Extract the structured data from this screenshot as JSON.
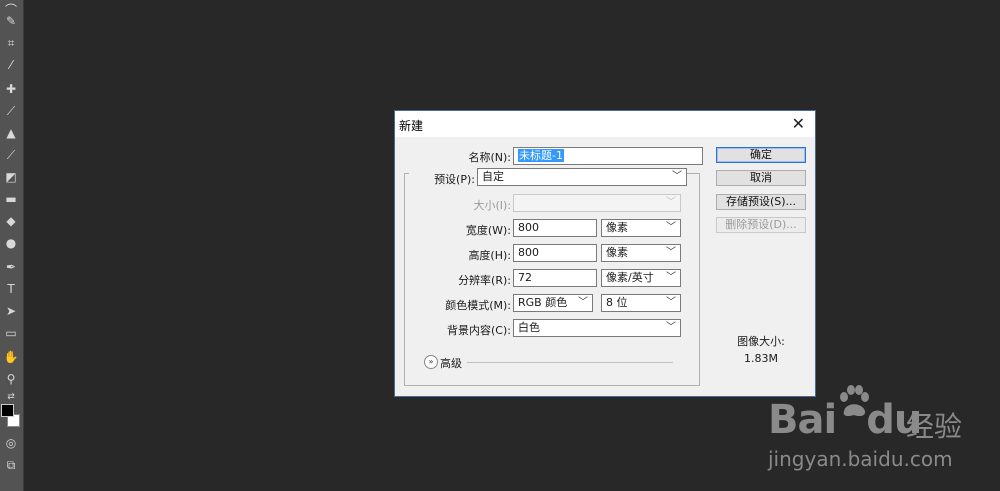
{
  "dialog": {
    "title": "新建",
    "name_label": "名称(N):",
    "name_value": "未标题-1",
    "preset_label": "预设(P):",
    "preset_value": "自定",
    "size_label": "大小(I):",
    "size_value": "",
    "width_label": "宽度(W):",
    "width_value": "800",
    "width_unit": "像素",
    "height_label": "高度(H):",
    "height_value": "800",
    "height_unit": "像素",
    "resolution_label": "分辨率(R):",
    "resolution_value": "72",
    "resolution_unit": "像素/英寸",
    "color_mode_label": "颜色模式(M):",
    "color_mode_value": "RGB 颜色",
    "bit_depth_value": "8 位",
    "bg_label": "背景内容(C):",
    "bg_value": "白色",
    "advanced_label": "高级",
    "buttons": {
      "ok": "确定",
      "cancel": "取消",
      "save_preset": "存储预设(S)...",
      "delete_preset": "删除预设(D)..."
    },
    "image_size_label": "图像大小:",
    "image_size_value": "1.83M"
  },
  "watermark": {
    "brand_1": "Bai",
    "brand_2": "du",
    "brand_cn": "经验",
    "url": "jingyan.baidu.com"
  },
  "colors": {
    "workspace": "#282828",
    "toolbar": "#535353",
    "dialog_bg": "#f0f0f0",
    "selection": "#3399ff",
    "primary_border": "#2b6fd8"
  }
}
